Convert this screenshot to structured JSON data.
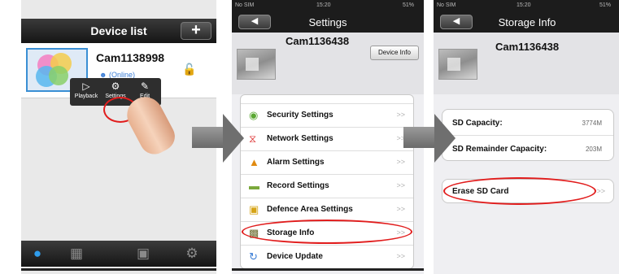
{
  "screen1": {
    "title": "Device list",
    "add_label": "+",
    "device_name": "Cam1138998",
    "device_status": "(Online)",
    "popup": {
      "playback": "Playback",
      "settings": "Settings",
      "edit": "Edit"
    }
  },
  "screen2": {
    "status": {
      "carrier": "No SIM",
      "time": "15:20",
      "battery": "51%"
    },
    "title": "Settings",
    "device_name": "Cam1136438",
    "device_info_label": "Device Info",
    "items": [
      {
        "label": "Security Settings",
        "icon": "shield-icon",
        "arrow": ">>"
      },
      {
        "label": "Network Settings",
        "icon": "wifi-icon",
        "arrow": ">>"
      },
      {
        "label": "Alarm Settings",
        "icon": "bell-icon",
        "arrow": ">>"
      },
      {
        "label": "Record Settings",
        "icon": "film-icon",
        "arrow": ">>"
      },
      {
        "label": "Defence Area Settings",
        "icon": "lock-icon",
        "arrow": ">>"
      },
      {
        "label": "Storage Info",
        "icon": "storage-icon",
        "arrow": ">>"
      },
      {
        "label": "Device Update",
        "icon": "update-icon",
        "arrow": ">>"
      }
    ]
  },
  "screen3": {
    "status": {
      "carrier": "No SIM",
      "time": "15:20",
      "battery": "51%"
    },
    "title": "Storage Info",
    "device_name": "Cam1136438",
    "sd_capacity_label": "SD Capacity:",
    "sd_capacity_value": "3774M",
    "sd_remainder_label": "SD Remainder Capacity:",
    "sd_remainder_value": "203M",
    "erase_label": "Erase SD Card",
    "erase_arrow": ">>"
  },
  "colors": {
    "highlight_ring": "#e11d1d",
    "active_tab": "#2f9ded",
    "header": "#1c1c1c"
  }
}
